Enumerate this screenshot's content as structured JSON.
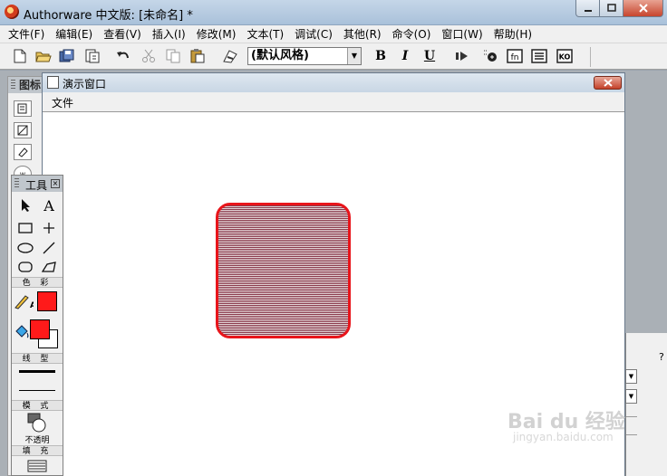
{
  "app": {
    "title": "Authorware 中文版: [未命名] *",
    "window_buttons": [
      "minimize-icon",
      "maximize-icon",
      "close-icon"
    ]
  },
  "menubar": {
    "items": [
      "文件(F)",
      "编辑(E)",
      "查看(V)",
      "插入(I)",
      "修改(M)",
      "文本(T)",
      "调试(C)",
      "其他(R)",
      "命令(O)",
      "窗口(W)",
      "帮助(H)"
    ]
  },
  "toolbar": {
    "style_combo_value": "(默认风格)",
    "bold_label": "B",
    "italic_label": "I",
    "underline_label": "U",
    "fn_label": "fn",
    "ko_label": "KO"
  },
  "icon_palette": {
    "title": "图标"
  },
  "presentation_window": {
    "title": "演示窗口",
    "menu_label": "文件",
    "shape": {
      "type": "rounded-rectangle",
      "stroke": "#e8151b",
      "fill_pattern": "horizontal-lines",
      "pattern_color": "#8a3a4c"
    }
  },
  "tools": {
    "title": "工具",
    "pointer": "pointer-icon",
    "text_tool": "A",
    "color_label": "色 彩",
    "line_label": "线 型",
    "mode_label": "模 式",
    "mode_value": "不透明",
    "fill_label": "填 充",
    "line_color": "#ff1a1a",
    "fill_fore_color": "#ff1a1a",
    "fill_back_color": "#ffffff"
  },
  "right_panel": {
    "help_mark": "?"
  },
  "watermark": {
    "text": "Bai du 经验",
    "sub": "jingyan.baidu.com"
  }
}
